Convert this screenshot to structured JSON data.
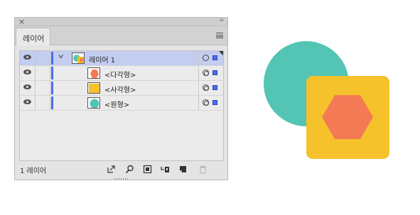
{
  "panel": {
    "close_glyph": "×",
    "collapse_glyph": "‹‹",
    "tab_label": "레이어",
    "menu_icon": "hamburger-menu-icon",
    "layers": [
      {
        "label": "레이어 1",
        "level": 0,
        "expanded": true,
        "selected": true,
        "thumbnail": "group"
      },
      {
        "label": "<다각형>",
        "level": 1,
        "selected": false,
        "thumbnail": "hexagon",
        "thumb_color": "#f47a55"
      },
      {
        "label": "<사각형>",
        "level": 1,
        "selected": false,
        "thumbnail": "square",
        "thumb_color": "#f5c22c"
      },
      {
        "label": "<원형>",
        "level": 1,
        "selected": false,
        "thumbnail": "circle",
        "thumb_color": "#54c4b4"
      }
    ],
    "status_text": "1 레이어",
    "toolbar_icons": [
      "export-icon",
      "search-icon",
      "clip-mask-icon",
      "sublayer-icon",
      "new-layer-icon",
      "trash-icon"
    ]
  },
  "colors": {
    "layer_color": "#4b6cf0",
    "selection_bg": "#c3cdf0",
    "circle": "#54c4b4",
    "square": "#f5c22c",
    "hexagon": "#f47a55"
  }
}
